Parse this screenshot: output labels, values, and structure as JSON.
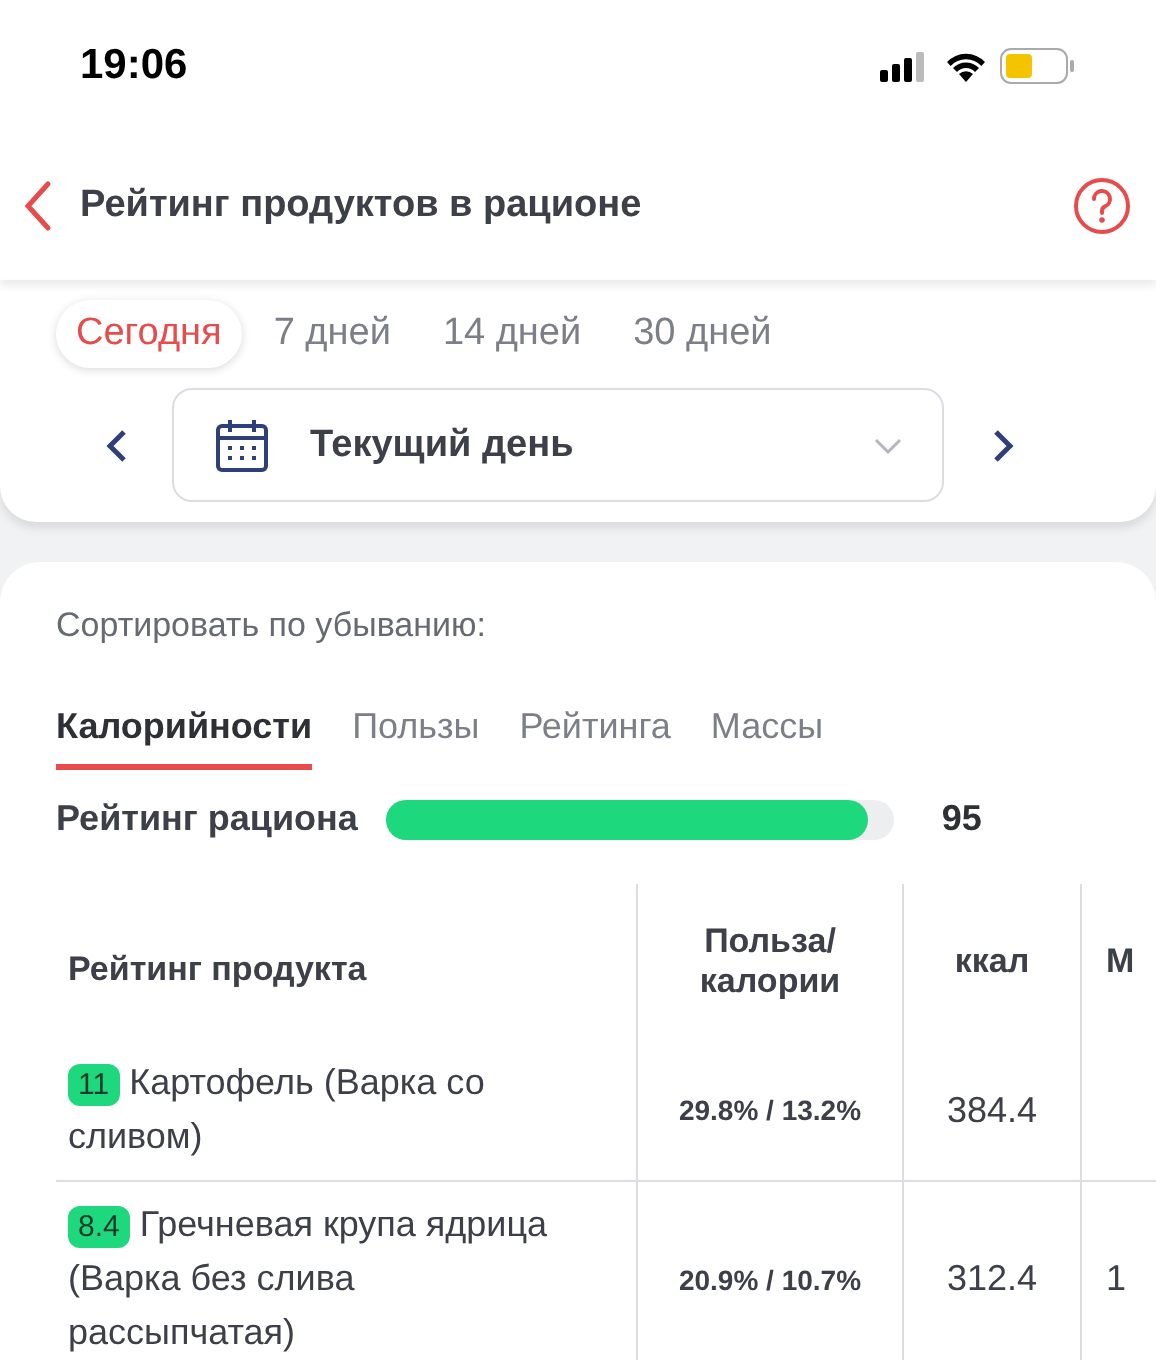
{
  "status_bar": {
    "time": "19:06"
  },
  "header": {
    "title": "Рейтинг продуктов в рационе"
  },
  "period_tabs": [
    {
      "label": "Сегодня",
      "selected": true
    },
    {
      "label": "7 дней",
      "selected": false
    },
    {
      "label": "14 дней",
      "selected": false
    },
    {
      "label": "30 дней",
      "selected": false
    }
  ],
  "date_picker": {
    "value": "Текущий день"
  },
  "sort": {
    "label": "Сортировать по убыванию:",
    "tabs": [
      {
        "label": "Калорийности",
        "selected": true
      },
      {
        "label": "Пользы",
        "selected": false
      },
      {
        "label": "Рейтинга",
        "selected": false
      },
      {
        "label": "Массы",
        "selected": false
      }
    ]
  },
  "diet_rating": {
    "label": "Рейтинг рациона",
    "level": 0.95,
    "value": "95"
  },
  "table": {
    "columns": [
      "Рейтинг продукта",
      "Польза/ калории",
      "ккал",
      "М"
    ],
    "rows": [
      {
        "cells": [
          {
            "score": "11",
            "name": "Картофель (Варка со сливом)"
          },
          "29.8% / 13.2%",
          "384.4",
          ""
        ]
      },
      {
        "cells": [
          {
            "score": "8.4",
            "name": "Гречневая крупа ядрица (Варка без слива рассыпчатая)"
          },
          "20.9% / 10.7%",
          "312.4",
          "1"
        ]
      }
    ]
  }
}
